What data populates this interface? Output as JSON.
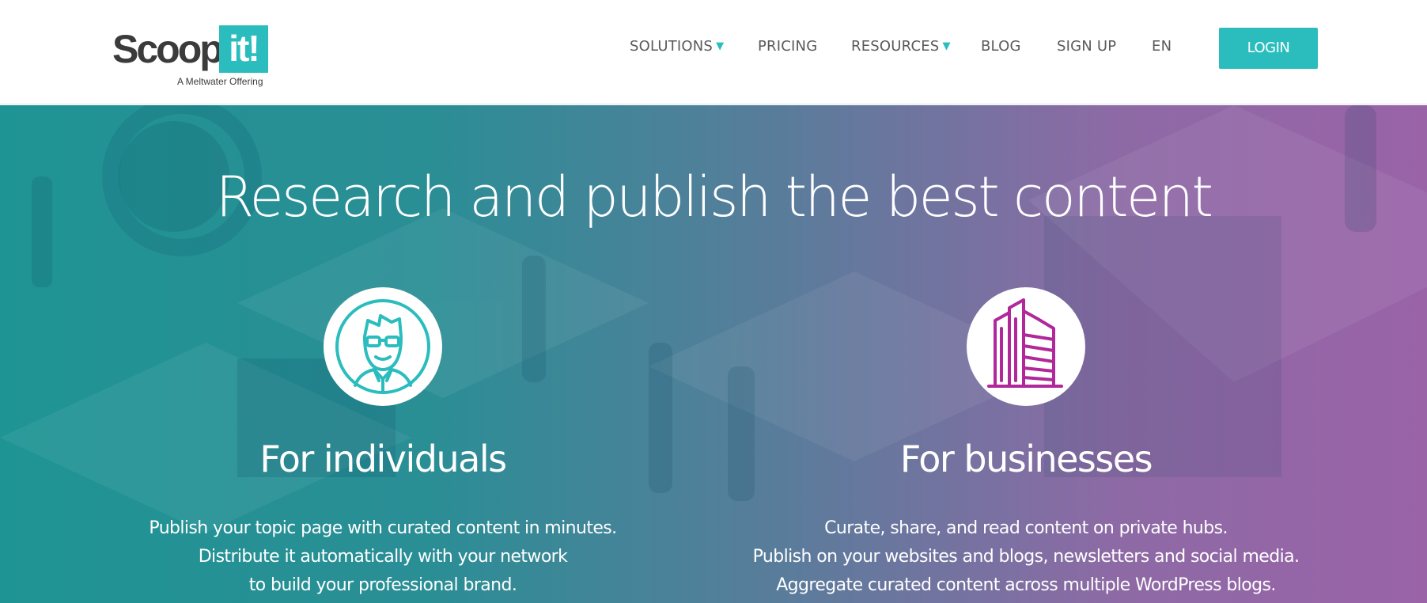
{
  "header": {
    "logo": {
      "word": "Scoop.",
      "box": "it!",
      "tagline": "A Meltwater Offering"
    },
    "nav": [
      {
        "label": "SOLUTIONS",
        "has_dropdown": true
      },
      {
        "label": "PRICING",
        "has_dropdown": false
      },
      {
        "label": "RESOURCES",
        "has_dropdown": true
      },
      {
        "label": "BLOG",
        "has_dropdown": false
      },
      {
        "label": "SIGN UP",
        "has_dropdown": false
      },
      {
        "label": "EN",
        "has_dropdown": false
      }
    ],
    "caret": "▼",
    "login_label": "LOGIN"
  },
  "hero": {
    "title": "Research and publish the best content",
    "individuals": {
      "icon": "person-glasses-icon",
      "title": "For individuals",
      "lines": [
        "Publish your topic page with curated content in minutes.",
        "Distribute it automatically with your network",
        "to build your professional brand."
      ]
    },
    "businesses": {
      "icon": "office-building-icon",
      "title": "For businesses",
      "lines": [
        "Curate, share, and read content on private hubs.",
        "Publish on your websites and blogs, newsletters and social media.",
        "Aggregate curated content across multiple WordPress blogs."
      ]
    }
  },
  "colors": {
    "brand_teal": "#2bbdbd",
    "brand_magenta": "#b0289a",
    "text_dark": "#3b3b3b"
  }
}
